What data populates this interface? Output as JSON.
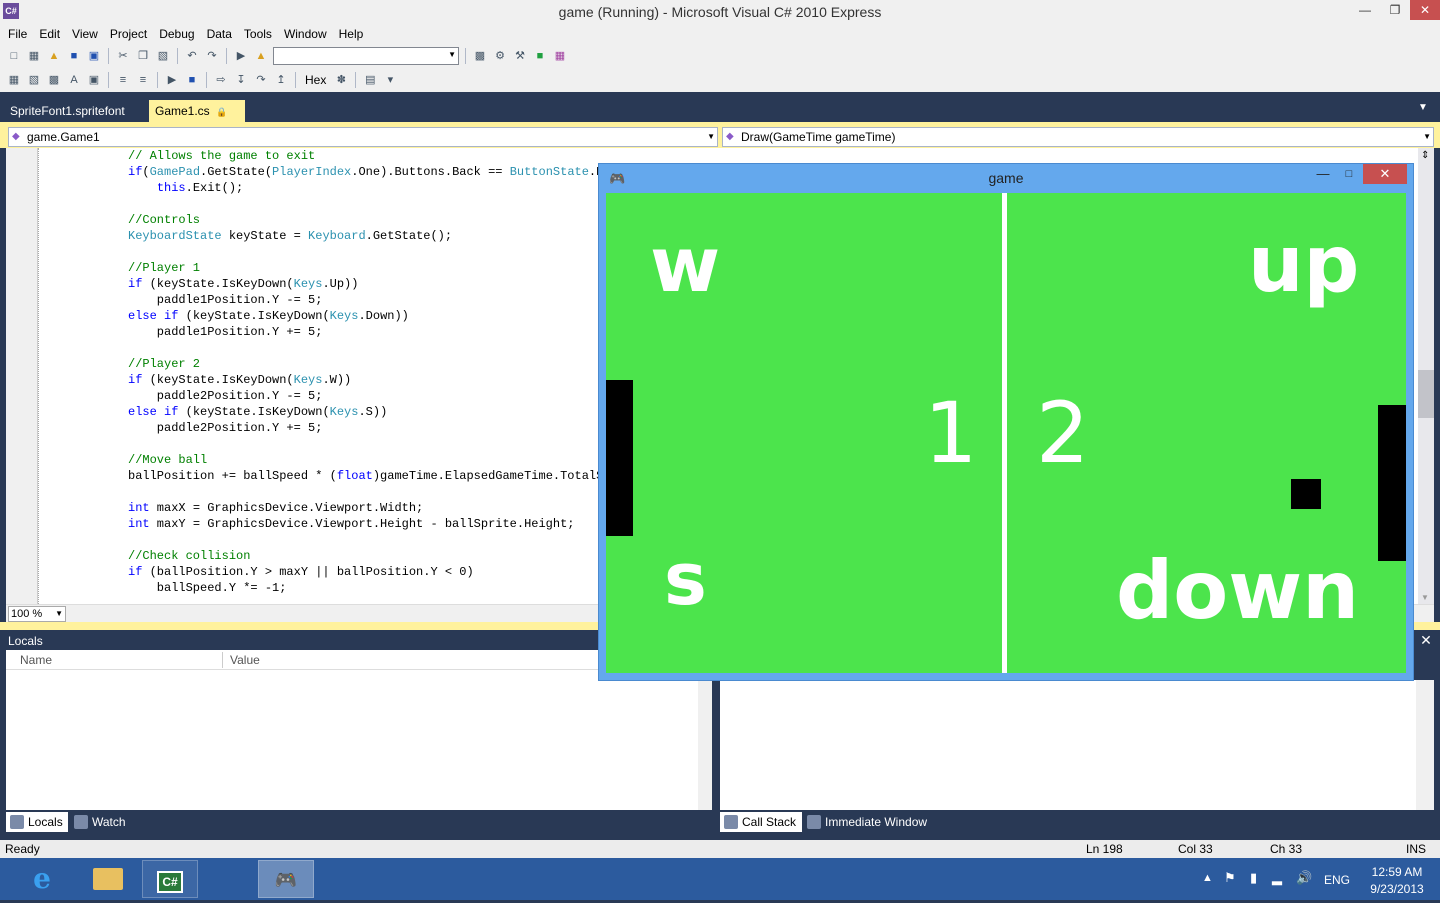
{
  "window": {
    "title": "game (Running) - Microsoft Visual C# 2010 Express",
    "icon_text": "C#"
  },
  "menu": [
    "File",
    "Edit",
    "View",
    "Project",
    "Debug",
    "Data",
    "Tools",
    "Window",
    "Help"
  ],
  "toolbar": {
    "hex_label": "Hex",
    "config_value": ""
  },
  "tabs": {
    "inactive": "SpriteFont1.spritefont",
    "active": "Game1.cs"
  },
  "nav": {
    "type_combo": "game.Game1",
    "member_combo": "Draw(GameTime gameTime)"
  },
  "editor": {
    "zoom": "100 %"
  },
  "code_lines": [
    [
      [
        "cm",
        "// Allows the game to exit"
      ]
    ],
    [
      [
        "kw",
        "if"
      ],
      [
        "",
        "("
      ],
      [
        "ty",
        "GamePad"
      ],
      [
        "",
        ".GetState("
      ],
      [
        "ty",
        "PlayerIndex"
      ],
      [
        "",
        ".One).Buttons.Back == "
      ],
      [
        "ty",
        "ButtonState"
      ],
      [
        "",
        ".P"
      ]
    ],
    [
      [
        "",
        "    "
      ],
      [
        "kw",
        "this"
      ],
      [
        "",
        ".Exit();"
      ]
    ],
    [],
    [
      [
        "cm",
        "//Controls"
      ]
    ],
    [
      [
        "ty",
        "KeyboardState"
      ],
      [
        "",
        " keyState = "
      ],
      [
        "ty",
        "Keyboard"
      ],
      [
        "",
        ".GetState();"
      ]
    ],
    [],
    [
      [
        "cm",
        "//Player 1"
      ]
    ],
    [
      [
        "kw",
        "if"
      ],
      [
        "",
        " (keyState.IsKeyDown("
      ],
      [
        "ty",
        "Keys"
      ],
      [
        "",
        ".Up))"
      ]
    ],
    [
      [
        "",
        "    paddle1Position.Y -= 5;"
      ]
    ],
    [
      [
        "kw",
        "else if"
      ],
      [
        "",
        " (keyState.IsKeyDown("
      ],
      [
        "ty",
        "Keys"
      ],
      [
        "",
        ".Down))"
      ]
    ],
    [
      [
        "",
        "    paddle1Position.Y += 5;"
      ]
    ],
    [],
    [
      [
        "cm",
        "//Player 2"
      ]
    ],
    [
      [
        "kw",
        "if"
      ],
      [
        "",
        " (keyState.IsKeyDown("
      ],
      [
        "ty",
        "Keys"
      ],
      [
        "",
        ".W))"
      ]
    ],
    [
      [
        "",
        "    paddle2Position.Y -= 5;"
      ]
    ],
    [
      [
        "kw",
        "else if"
      ],
      [
        "",
        " (keyState.IsKeyDown("
      ],
      [
        "ty",
        "Keys"
      ],
      [
        "",
        ".S))"
      ]
    ],
    [
      [
        "",
        "    paddle2Position.Y += 5;"
      ]
    ],
    [],
    [
      [
        "cm",
        "//Move ball"
      ]
    ],
    [
      [
        "",
        "ballPosition += ballSpeed * ("
      ],
      [
        "kw",
        "float"
      ],
      [
        "",
        ")gameTime.ElapsedGameTime.TotalSe"
      ]
    ],
    [],
    [
      [
        "kw",
        "int"
      ],
      [
        "",
        " maxX = GraphicsDevice.Viewport.Width;"
      ]
    ],
    [
      [
        "kw",
        "int"
      ],
      [
        "",
        " maxY = GraphicsDevice.Viewport.Height - ballSprite.Height;"
      ]
    ],
    [],
    [
      [
        "cm",
        "//Check collision"
      ]
    ],
    [
      [
        "kw",
        "if"
      ],
      [
        "",
        " (ballPosition.Y > maxY || ballPosition.Y < 0)"
      ]
    ],
    [
      [
        "",
        "    ballSpeed.Y *= -1;"
      ]
    ]
  ],
  "locals": {
    "title": "Locals",
    "col_name": "Name",
    "col_value": "Value"
  },
  "bottom_tabs": {
    "locals": "Locals",
    "watch": "Watch",
    "callstack": "Call Stack",
    "immediate": "Immediate Window"
  },
  "status": {
    "ready": "Ready",
    "ln": "Ln 198",
    "col": "Col 33",
    "ch": "Ch 33",
    "ins": "INS"
  },
  "game": {
    "title": "game",
    "left_top": "w",
    "left_bottom": "s",
    "right_top": "up",
    "right_bottom": "down",
    "score_left": "1",
    "score_right": "2"
  },
  "taskbar": {
    "lang": "ENG",
    "time": "12:59 AM",
    "date": "9/23/2013"
  }
}
